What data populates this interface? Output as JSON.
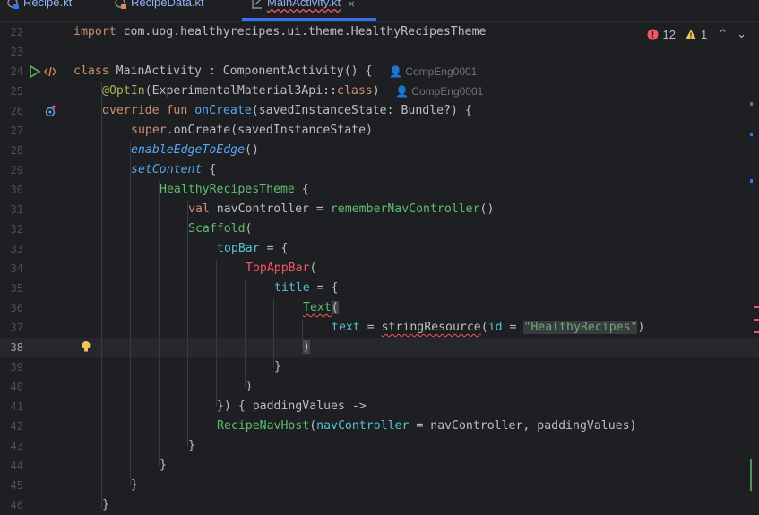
{
  "tabs": [
    {
      "label": "Recipe.kt",
      "active": false
    },
    {
      "label": "RecipeData.kt",
      "active": false
    },
    {
      "label": "MainActivity.kt",
      "active": true
    }
  ],
  "inspection": {
    "errors": "12",
    "warnings": "1"
  },
  "lines": [
    {
      "num": "22",
      "html_tokens": [
        [
          "kw",
          "import "
        ],
        [
          "plain",
          "com.uog.healthyrecipes.ui.theme.HealthyRecipesTheme"
        ]
      ]
    },
    {
      "num": "23",
      "html_tokens": []
    },
    {
      "num": "24",
      "html_tokens": [
        [
          "kw",
          "class "
        ],
        [
          "plain",
          "MainActivity : ComponentActivity() {"
        ]
      ]
    },
    {
      "num": "25",
      "html_tokens": [
        [
          "anno",
          "@OptIn"
        ],
        [
          "plain",
          "(ExperimentalMaterial3Api::"
        ],
        [
          "kw",
          "class"
        ],
        [
          "plain",
          ")"
        ]
      ]
    },
    {
      "num": "26",
      "html_tokens": [
        [
          "kw",
          "override fun "
        ],
        [
          "fn",
          "onCreate"
        ],
        [
          "plain",
          "(savedInstanceState: Bundle?) {"
        ]
      ]
    },
    {
      "num": "27",
      "html_tokens": [
        [
          "kw",
          "super"
        ],
        [
          "plain",
          ".onCreate(savedInstanceState)"
        ]
      ]
    },
    {
      "num": "28",
      "html_tokens": [
        [
          "ital",
          "enableEdgeToEdge"
        ],
        [
          "plain",
          "()"
        ]
      ]
    },
    {
      "num": "29",
      "html_tokens": [
        [
          "ital",
          "setContent"
        ],
        [
          "plain",
          " {"
        ]
      ]
    },
    {
      "num": "30",
      "html_tokens": [
        [
          "comp",
          "HealthyRecipesTheme"
        ],
        [
          "plain",
          " {"
        ]
      ]
    },
    {
      "num": "31",
      "html_tokens": [
        [
          "kw",
          "val "
        ],
        [
          "plain",
          "navController = "
        ],
        [
          "comp",
          "rememberNavController"
        ],
        [
          "plain",
          "()"
        ]
      ]
    },
    {
      "num": "32",
      "html_tokens": [
        [
          "comp",
          "Scaffold"
        ],
        [
          "plain",
          "("
        ]
      ]
    },
    {
      "num": "33",
      "html_tokens": [
        [
          "param",
          "topBar"
        ],
        [
          "plain",
          " = {"
        ]
      ]
    },
    {
      "num": "34",
      "html_tokens": [
        [
          "err",
          "TopAppBar"
        ],
        [
          "plain",
          "("
        ]
      ]
    },
    {
      "num": "35",
      "html_tokens": [
        [
          "param",
          "title"
        ],
        [
          "plain",
          " = {"
        ]
      ]
    },
    {
      "num": "36",
      "html_tokens": [
        [
          "comp",
          "Text"
        ],
        [
          "bracket",
          "("
        ]
      ]
    },
    {
      "num": "37",
      "html_tokens": [
        [
          "param",
          "text"
        ],
        [
          "plain",
          " = "
        ],
        [
          "wavyplain",
          "stringResource"
        ],
        [
          "plain",
          "("
        ],
        [
          "param",
          "id"
        ],
        [
          "plain",
          " = "
        ],
        [
          "str",
          "\"HealthyRecipes\""
        ],
        [
          "plain",
          ")"
        ]
      ]
    },
    {
      "num": "38",
      "html_tokens": [
        [
          "bracket",
          ")"
        ]
      ]
    },
    {
      "num": "39",
      "html_tokens": [
        [
          "plain",
          "}"
        ]
      ]
    },
    {
      "num": "40",
      "html_tokens": [
        [
          "plain",
          ")"
        ]
      ]
    },
    {
      "num": "41",
      "html_tokens": [
        [
          "plain",
          "}) { paddingValues ->"
        ]
      ]
    },
    {
      "num": "42",
      "html_tokens": [
        [
          "comp",
          "RecipeNavHost"
        ],
        [
          "plain",
          "("
        ],
        [
          "param",
          "navController"
        ],
        [
          "plain",
          " = navController, paddingValues)"
        ]
      ]
    },
    {
      "num": "43",
      "html_tokens": [
        [
          "plain",
          "}"
        ]
      ]
    },
    {
      "num": "44",
      "html_tokens": [
        [
          "plain",
          "}"
        ]
      ]
    },
    {
      "num": "45",
      "html_tokens": [
        [
          "plain",
          "}"
        ]
      ]
    },
    {
      "num": "46",
      "html_tokens": [
        [
          "plain",
          "}"
        ]
      ]
    }
  ],
  "hints": {
    "line24": "CompEng0001",
    "line25": "CompEng0001"
  },
  "icons": {
    "run": "run-gutter-icon",
    "tag": "code-tag-icon",
    "override": "override-gutter-icon",
    "bulb": "lightbulb-icon",
    "error": "error-icon",
    "warning": "warning-icon",
    "chevron_up": "chevron-up-icon",
    "chevron_down": "chevron-down-icon"
  },
  "colors": {
    "accent": "#3574f0",
    "error": "#f75464",
    "keyword": "#cf8e6d",
    "function": "#56a8f5",
    "compose": "#5ebd6e",
    "string": "#6aab73"
  }
}
